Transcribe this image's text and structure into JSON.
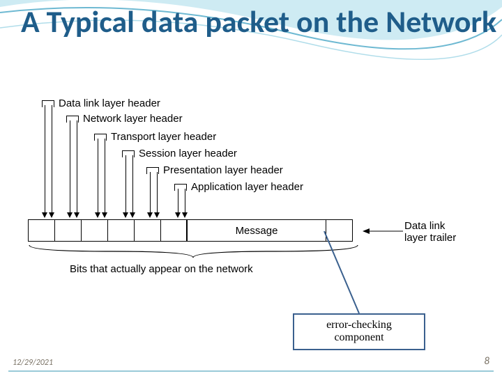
{
  "title": "A Typical data packet on the Network",
  "headers": {
    "data_link": "Data link layer header",
    "network": "Network layer header",
    "transport": "Transport layer header",
    "session": "Session layer header",
    "presentation": "Presentation layer header",
    "application": "Application layer header"
  },
  "message": "Message",
  "trailer": "Data link\nlayer trailer",
  "bits": "Bits that actually appear on the network",
  "callout": "error-checking component",
  "footer": {
    "date": "12/29/2021",
    "page": "8"
  }
}
